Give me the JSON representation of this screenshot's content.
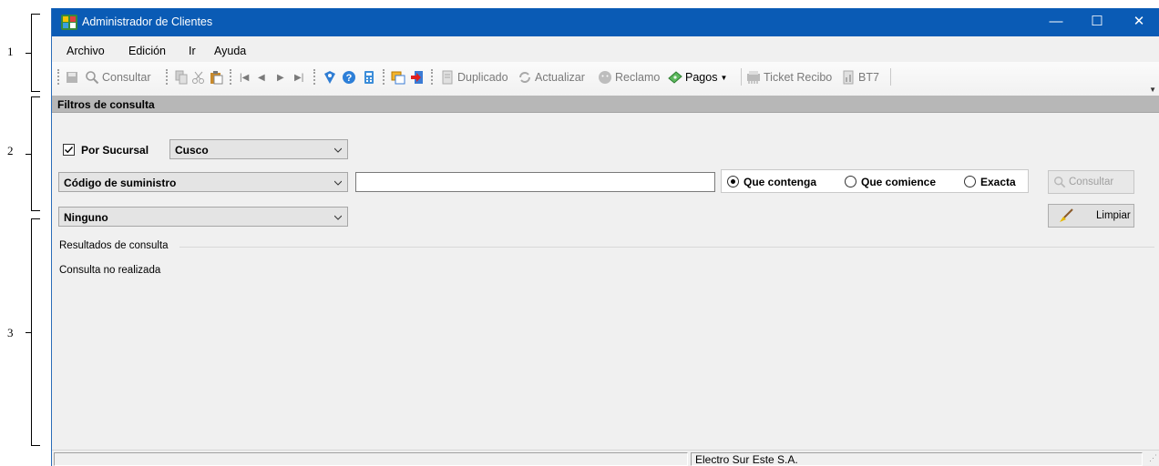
{
  "annotations": [
    "1",
    "2",
    "3"
  ],
  "window": {
    "title": "Administrador de Clientes",
    "controls": {
      "minimize": "—",
      "maximize": "☐",
      "close": "✕"
    }
  },
  "menu": [
    "Archivo",
    "Edición",
    "Ir",
    "Ayuda"
  ],
  "toolbar": {
    "consultar": "Consultar",
    "duplicado": "Duplicado",
    "actualizar": "Actualizar",
    "reclamo": "Reclamo",
    "pagos": "Pagos",
    "ticket_recibo": "Ticket Recibo",
    "bt7": "BT7"
  },
  "filters": {
    "title": "Filtros de consulta",
    "por_sucursal": {
      "label": "Por Sucursal",
      "checked": true,
      "value": "Cusco"
    },
    "field_combo": "Código de suministro",
    "search_value": "",
    "match_options": [
      {
        "label": "Que contenga",
        "selected": true
      },
      {
        "label": "Que comience",
        "selected": false
      },
      {
        "label": "Exacta",
        "selected": false
      }
    ],
    "third_combo": "Ninguno",
    "consultar_button": "Consultar",
    "limpiar_button": "Limpiar"
  },
  "results": {
    "title": "Resultados de consulta",
    "empty_text": "Consulta no realizada"
  },
  "status": {
    "company": "Electro Sur Este S.A."
  },
  "colors": {
    "titlebar": "#0a5bb5",
    "panel_header": "#b7b7b7",
    "background": "#f0f0f0"
  }
}
